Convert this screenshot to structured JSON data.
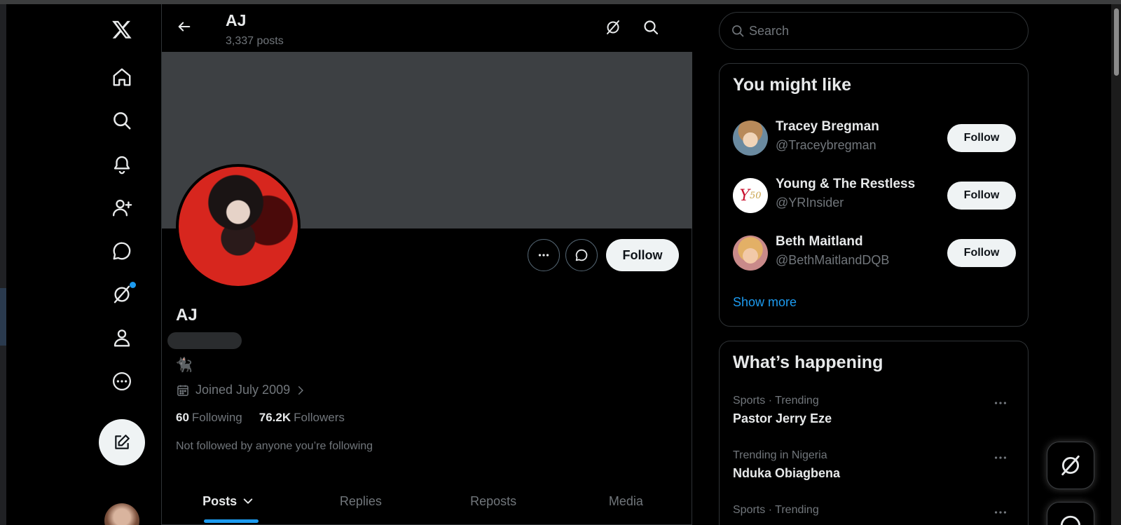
{
  "profile_header": {
    "title": "AJ",
    "posts_count": "3,337 posts"
  },
  "profile": {
    "name": "AJ",
    "bio_emoji": "🐈‍⬛",
    "joined": "Joined July 2009",
    "following_count": "60",
    "following_label": "Following",
    "followers_count": "76.2K",
    "followers_label": "Followers",
    "not_followed_text": "Not followed by anyone you’re following",
    "follow_label": "Follow"
  },
  "tabs": [
    {
      "label": "Posts",
      "active": true
    },
    {
      "label": "Replies"
    },
    {
      "label": "Reposts"
    },
    {
      "label": "Media"
    }
  ],
  "search": {
    "placeholder": "Search"
  },
  "who_to_follow": {
    "title": "You might like",
    "items": [
      {
        "name": "Tracey Bregman",
        "handle": "@Traceybregman",
        "button": "Follow"
      },
      {
        "name": "Young & The Restless",
        "handle": "@YRInsider",
        "button": "Follow"
      },
      {
        "name": "Beth Maitland",
        "handle": "@BethMaitlandDQB",
        "button": "Follow"
      }
    ],
    "show_more": "Show more"
  },
  "whats_happening": {
    "title": "What’s happening",
    "items": [
      {
        "meta": "Sports · Trending",
        "name": "Pastor Jerry Eze"
      },
      {
        "meta": "Trending in Nigeria",
        "name": "Nduka Obiagbena"
      },
      {
        "meta": "Sports · Trending",
        "name": ""
      }
    ]
  },
  "colors": {
    "accent": "#1d9bf0",
    "background": "#000000",
    "banner": "#3d4043",
    "text_secondary": "#71767b",
    "button_light": "#eff3f4"
  },
  "icons": {
    "nav": [
      "x-logo-icon",
      "home-icon",
      "explore-icon",
      "notifications-icon",
      "follow-icon",
      "messages-icon",
      "grok-icon",
      "profile-icon",
      "more-icon"
    ],
    "compose": "compose-icon"
  }
}
